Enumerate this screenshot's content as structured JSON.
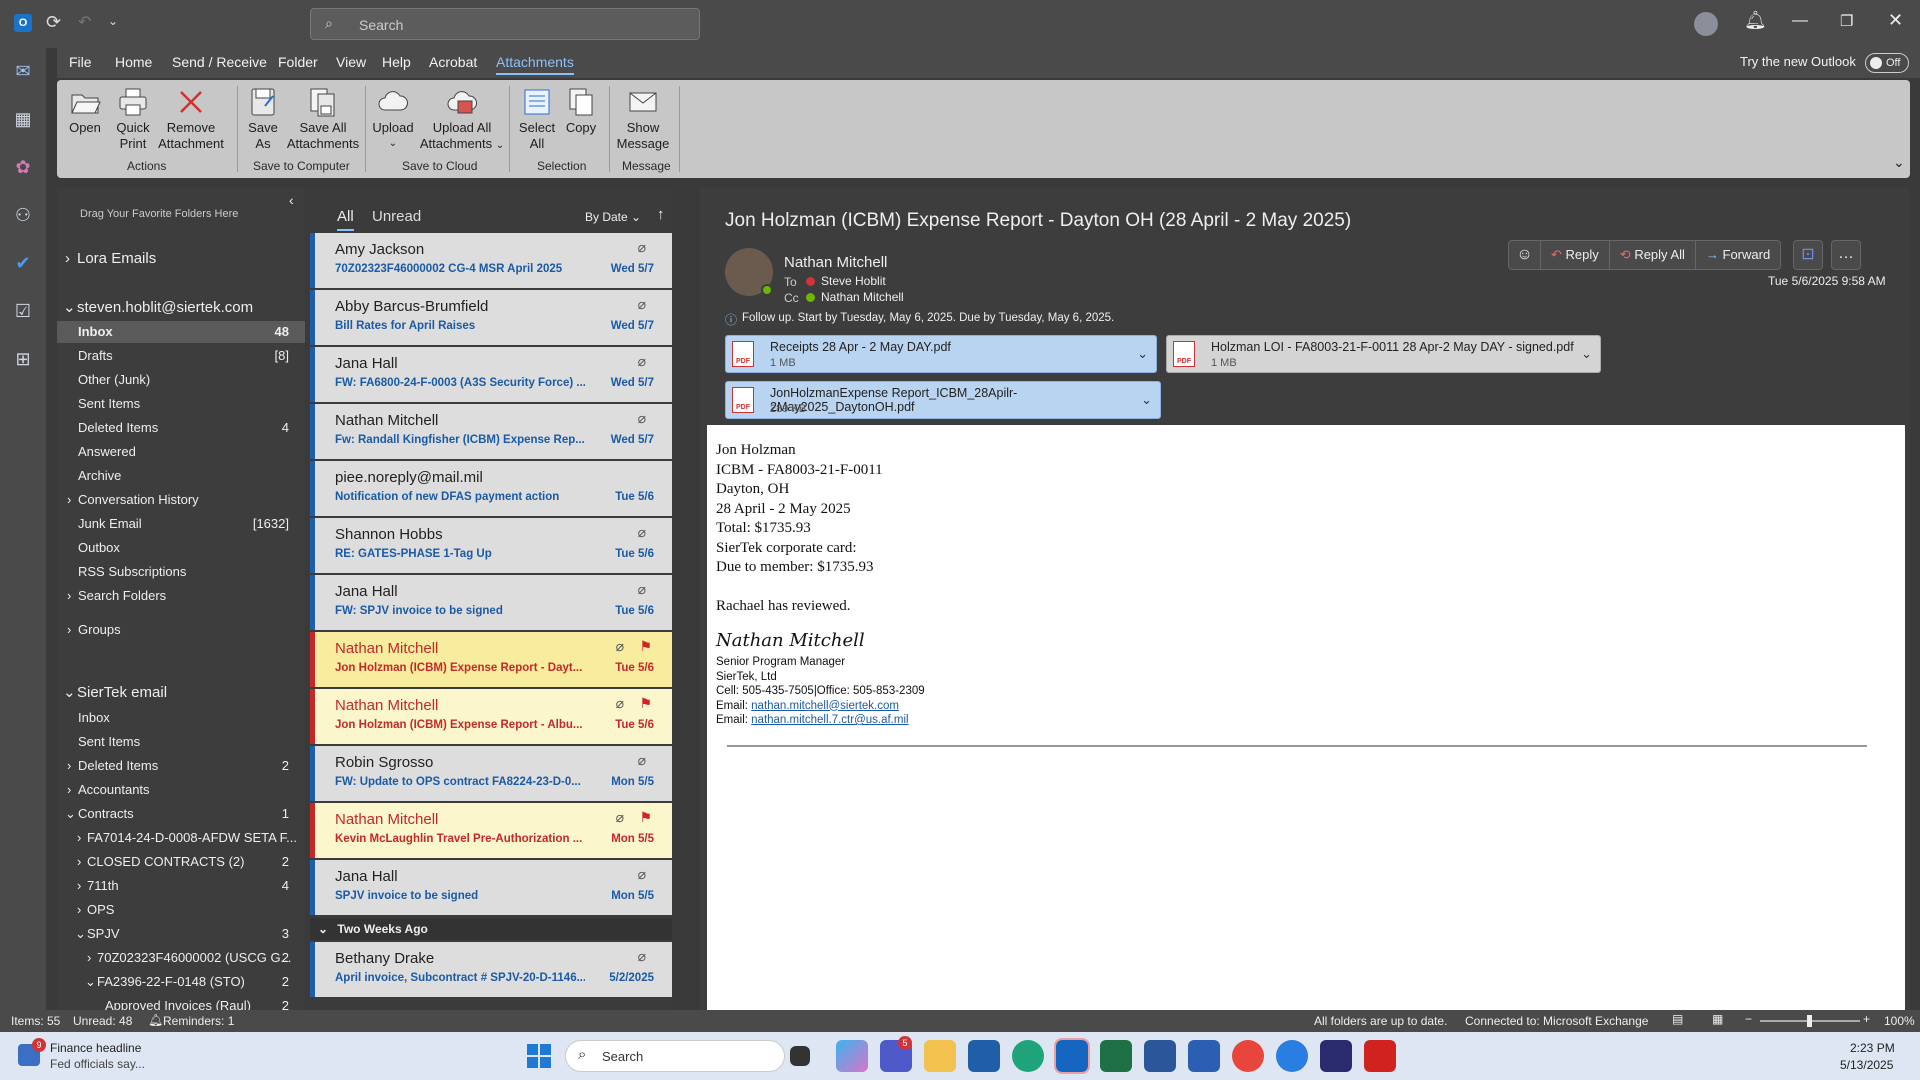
{
  "titlebar": {
    "search_placeholder": "Search"
  },
  "menu": [
    "File",
    "Home",
    "Send / Receive",
    "Folder",
    "View",
    "Help",
    "Acrobat",
    "Attachments"
  ],
  "try_new": {
    "label": "Try the new Outlook",
    "toggle": "Off"
  },
  "ribbon": {
    "buttons": [
      {
        "l1": "Open",
        "l2": ""
      },
      {
        "l1": "Quick",
        "l2": "Print"
      },
      {
        "l1": "Remove",
        "l2": "Attachment"
      },
      {
        "l1": "Save",
        "l2": "As"
      },
      {
        "l1": "Save All",
        "l2": "Attachments"
      },
      {
        "l1": "Upload",
        "l2": ""
      },
      {
        "l1": "Upload All",
        "l2": "Attachments"
      },
      {
        "l1": "Select",
        "l2": "All"
      },
      {
        "l1": "Copy",
        "l2": ""
      },
      {
        "l1": "Show",
        "l2": "Message"
      }
    ],
    "groups": [
      "Actions",
      "Save to Computer",
      "Save to Cloud",
      "Selection",
      "Message"
    ]
  },
  "folders": {
    "drag_hint": "Drag Your Favorite Folders Here",
    "items": [
      {
        "label": "Lora Emails",
        "count": "",
        "head": true
      },
      {
        "label": "steven.hoblit@siertek.com",
        "count": "",
        "head": true
      },
      {
        "label": "Inbox",
        "count": "48",
        "sel": true
      },
      {
        "label": "Drafts",
        "count": "[8]"
      },
      {
        "label": "Other (Junk)",
        "count": ""
      },
      {
        "label": "Sent Items",
        "count": ""
      },
      {
        "label": "Deleted Items",
        "count": "4"
      },
      {
        "label": "Answered",
        "count": ""
      },
      {
        "label": "Archive",
        "count": ""
      },
      {
        "label": "Conversation History",
        "count": ""
      },
      {
        "label": "Junk Email",
        "count": "[1632]"
      },
      {
        "label": "Outbox",
        "count": ""
      },
      {
        "label": "RSS Subscriptions",
        "count": ""
      },
      {
        "label": "Search Folders",
        "count": ""
      },
      {
        "label": "Groups",
        "count": ""
      },
      {
        "label": "SierTek email",
        "count": "",
        "head": true
      },
      {
        "label": "Inbox",
        "count": ""
      },
      {
        "label": "Sent Items",
        "count": ""
      },
      {
        "label": "Deleted Items",
        "count": "2"
      },
      {
        "label": "Accountants",
        "count": ""
      },
      {
        "label": "Contracts",
        "count": "1"
      },
      {
        "label": "FA7014-24-D-0008-AFDW SETA F...",
        "count": ""
      },
      {
        "label": "CLOSED CONTRACTS (2)",
        "count": "2"
      },
      {
        "label": "711th",
        "count": "4"
      },
      {
        "label": "OPS",
        "count": ""
      },
      {
        "label": "SPJV",
        "count": "3"
      },
      {
        "label": "70Z02323F46000002 (USCG G...",
        "count": "2"
      },
      {
        "label": "FA2396-22-F-0148 (STO)",
        "count": "2"
      },
      {
        "label": "Approved Invoices (Raul)",
        "count": "2"
      }
    ]
  },
  "list": {
    "tabs": [
      "All",
      "Unread"
    ],
    "sort": "By Date",
    "group_two_weeks": "Two Weeks Ago",
    "messages": [
      {
        "sender": "Amy Jackson",
        "subject": "70Z02323F46000002  CG-4  MSR April 2025",
        "date": "Wed 5/7"
      },
      {
        "sender": "Abby Barcus-Brumfield",
        "subject": "Bill Rates for April Raises",
        "date": "Wed 5/7"
      },
      {
        "sender": "Jana Hall",
        "subject": "FW: FA6800-24-F-0003 (A3S Security Force) ...",
        "date": "Wed 5/7"
      },
      {
        "sender": "Nathan Mitchell",
        "subject": "Fw: Randall Kingfisher (ICBM) Expense Rep...",
        "date": "Wed 5/7"
      },
      {
        "sender": "piee.noreply@mail.mil",
        "subject": "Notification of new DFAS payment action",
        "date": "Tue 5/6"
      },
      {
        "sender": "Shannon Hobbs",
        "subject": "RE: GATES-PHASE 1-Tag Up",
        "date": "Tue 5/6"
      },
      {
        "sender": "Jana Hall",
        "subject": "FW: SPJV invoice to be signed",
        "date": "Tue 5/6"
      },
      {
        "sender": "Nathan Mitchell",
        "subject": "Jon Holzman (ICBM) Expense Report - Dayt...",
        "date": "Tue 5/6"
      },
      {
        "sender": "Nathan Mitchell",
        "subject": "Jon Holzman (ICBM) Expense Report - Albu...",
        "date": "Tue 5/6"
      },
      {
        "sender": "Robin Sgrosso",
        "subject": "FW: Update to OPS contract FA8224-23-D-0...",
        "date": "Mon 5/5"
      },
      {
        "sender": "Nathan Mitchell",
        "subject": "Kevin McLaughlin Travel Pre-Authorization ...",
        "date": "Mon 5/5"
      },
      {
        "sender": "Jana Hall",
        "subject": "SPJV invoice to be signed",
        "date": "Mon 5/5"
      },
      {
        "sender": "Bethany Drake",
        "subject": "April invoice, Subcontract # SPJV-20-D-1146...",
        "date": "5/2/2025"
      }
    ]
  },
  "reading": {
    "subject": "Jon Holzman (ICBM) Expense Report - Dayton OH (28 April - 2 May 2025)",
    "from": "Nathan Mitchell",
    "to_label": "To",
    "to": "Steve Hoblit",
    "cc_label": "Cc",
    "cc": "Nathan Mitchell",
    "datetime": "Tue 5/6/2025 9:58 AM",
    "followup": "Follow up.  Start by Tuesday, May 6, 2025.  Due by Tuesday, May 6, 2025.",
    "actions": [
      "Reply",
      "Reply All",
      "Forward"
    ],
    "attachments": [
      {
        "name": "Receipts 28 Apr - 2 May DAY.pdf",
        "size": "1 MB"
      },
      {
        "name": "Holzman LOI - FA8003-21-F-0011 28 Apr-2 May DAY - signed.pdf",
        "size": "1 MB"
      },
      {
        "name": "JonHolzmanExpense Report_ICBM_28Apilr-2May2025_DaytonOH.pdf",
        "size": "289 KB"
      }
    ],
    "pdf_label": "PDF",
    "body_lines": [
      "Jon Holzman",
      "ICBM - FA8003-21-F-0011",
      "Dayton, OH",
      "28 April - 2 May 2025",
      "Total: $1735.93",
      "SierTek corporate card:",
      "Due to member: $1735.93"
    ],
    "reviewed": "Rachael has reviewed.",
    "sig_name": "Nathan Mitchell",
    "sig_title": "Senior Program Manager",
    "sig_company": "SierTek, Ltd",
    "sig_phone": "Cell: 505-435-7505|Office: 505-853-2309",
    "email_label": "Email:",
    "email1": "nathan.mitchell@siertek.com",
    "email2": "nathan.mitchell.7.ctr@us.af.mil"
  },
  "status": {
    "items": "Items: 55",
    "unread": "Unread: 48",
    "reminders": "Reminders: 1",
    "sync": "All folders are up to date.",
    "conn": "Connected to: Microsoft Exchange",
    "zoom": "100%"
  },
  "taskbar": {
    "news_title": "Finance headline",
    "news_sub": "Fed officials say...",
    "news_badge": "9",
    "search": "Search",
    "teams_badge": "5",
    "time": "2:23 PM",
    "date": "5/13/2025"
  }
}
